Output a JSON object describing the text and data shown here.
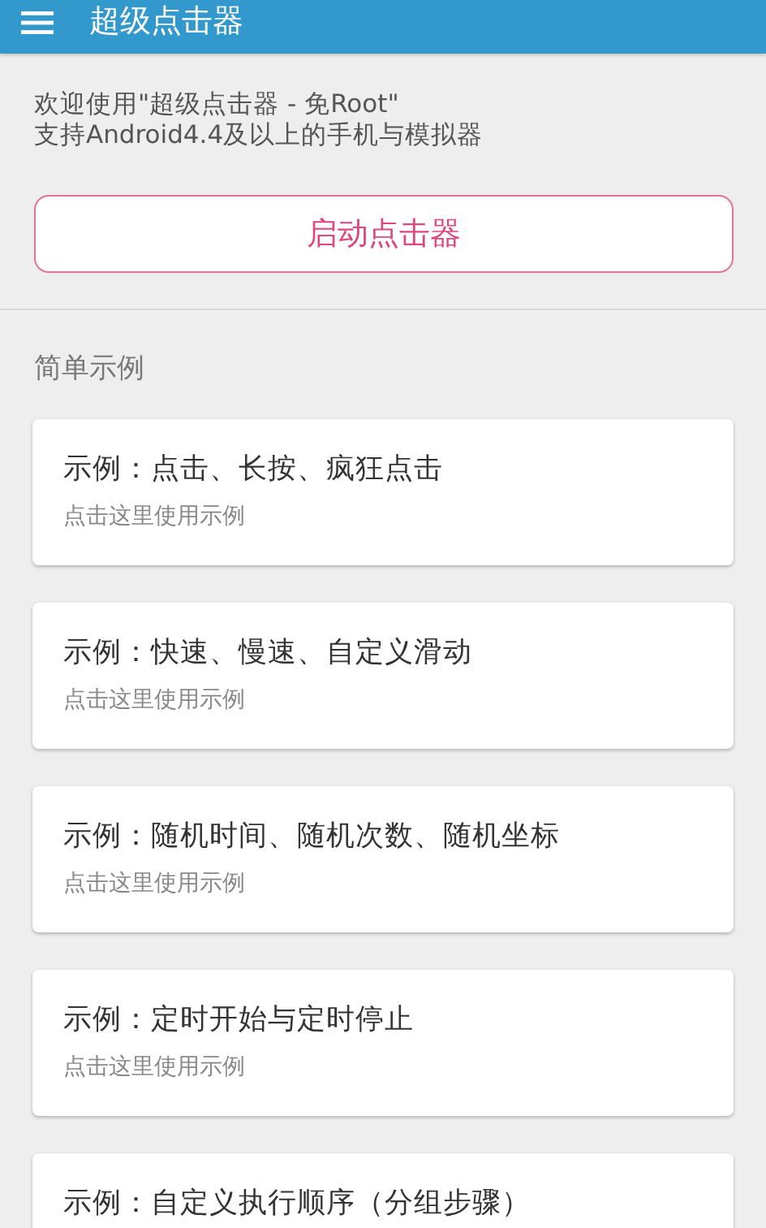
{
  "app_bar": {
    "title": "超级点击器"
  },
  "intro": [
    "欢迎使用\"超级点击器 - 免Root\"",
    "支持Android4.4及以上的手机与模拟器"
  ],
  "start_button": {
    "label": "启动点击器"
  },
  "section": {
    "title": "简单示例"
  },
  "examples": [
    {
      "title": "示例：点击、长按、疯狂点击",
      "subtitle": "点击这里使用示例"
    },
    {
      "title": "示例：快速、慢速、自定义滑动",
      "subtitle": "点击这里使用示例"
    },
    {
      "title": "示例：随机时间、随机次数、随机坐标",
      "subtitle": "点击这里使用示例"
    },
    {
      "title": "示例：定时开始与定时停止",
      "subtitle": "点击这里使用示例"
    },
    {
      "title": "示例：自定义执行顺序（分组步骤）"
    }
  ]
}
